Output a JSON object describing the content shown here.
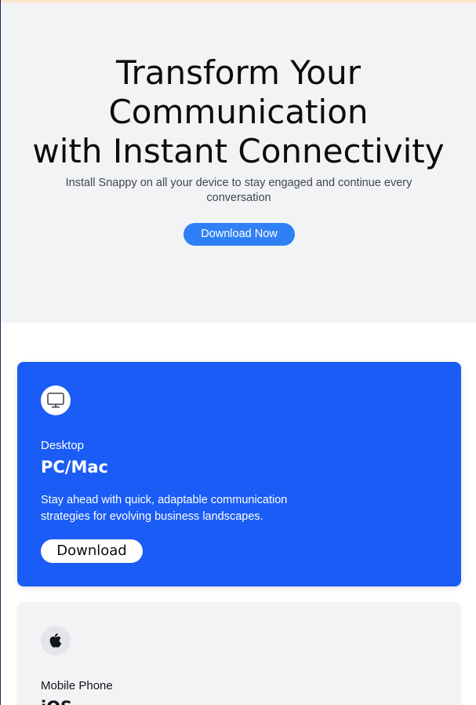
{
  "hero": {
    "title_lines": [
      "Transform Your",
      "Communication",
      "with Instant Connectivity"
    ],
    "subtitle": "Install Snappy on all your device to stay engaged and continue every conversation",
    "cta_label": "Download Now"
  },
  "cards": [
    {
      "icon": "monitor-icon",
      "kicker": "Desktop",
      "name": "PC/Mac",
      "description": "Stay ahead with quick, adaptable communication strategies for evolving business landscapes.",
      "button_label": "Download"
    },
    {
      "icon": "apple-icon",
      "kicker": "Mobile Phone",
      "name": "iOS"
    }
  ],
  "colors": {
    "hero_bg": "#f2f3f5",
    "accent": "#2f80f5",
    "card_active_bg": "#1a5cf5",
    "card_bg": "#f2f3f5"
  }
}
